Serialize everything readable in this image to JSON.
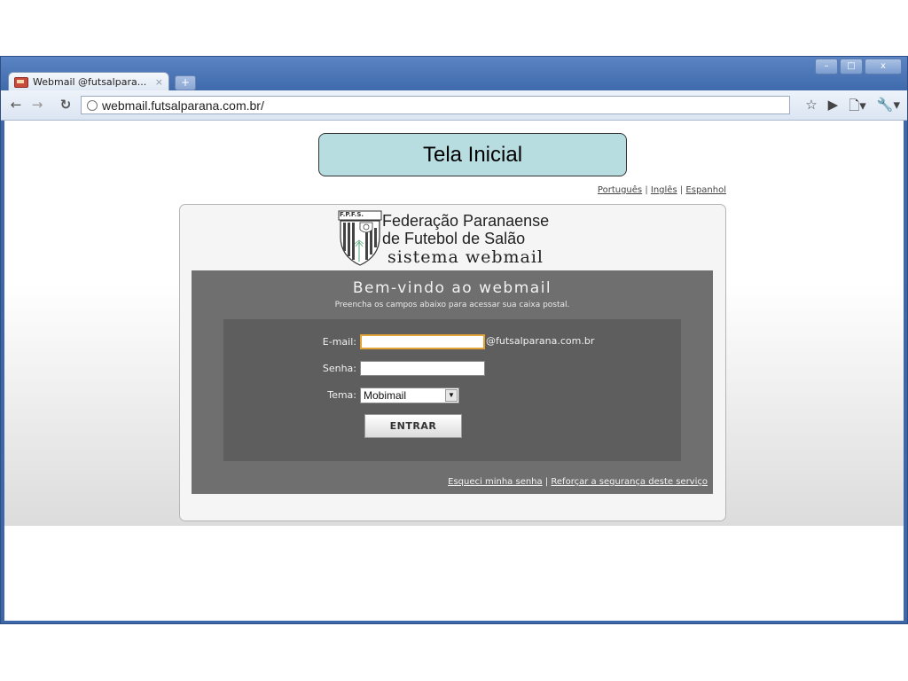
{
  "browser": {
    "tab_title": "Webmail @futsalpara...",
    "tab_close": "×",
    "new_tab": "+",
    "url": "webmail.futsalparana.com.br/",
    "window_buttons": [
      "–",
      "□",
      "x"
    ],
    "icons": [
      "back-icon",
      "forward-icon",
      "reload-icon",
      "globe-icon",
      "star-icon",
      "play-icon",
      "page-icon",
      "wrench-icon"
    ]
  },
  "slide": {
    "title": "Tela Inicial"
  },
  "languages": {
    "portugues": "Português",
    "ingles": "Inglês",
    "espanhol": "Espanhol",
    "separator": "|"
  },
  "logo": {
    "badge": "F.P.F.S.",
    "line1": "Federação Paranaense",
    "line2": "de Futebol de Salão",
    "line3": "sistema webmail"
  },
  "login": {
    "welcome": "Bem-vindo ao webmail",
    "subtitle": "Preencha os campos abaixo para acessar sua caixa postal.",
    "email_label": "E-mail:",
    "email_value": "",
    "domain_suffix": "@futsalparana.com.br",
    "password_label": "Senha:",
    "password_value": "",
    "theme_label": "Tema:",
    "theme_selected": "Mobimail",
    "submit_label": "ENTRAR",
    "forgot_link": "Esqueci minha senha",
    "security_link": "Reforçar a segurança deste serviço",
    "separator": "|"
  },
  "colors": {
    "window_frame": "#3d67a8",
    "slide_title_bg": "#b7dde1",
    "panel_bg": "#6f6f6f",
    "inner_bg": "#5e5e5e",
    "focus_border": "#e1a336"
  }
}
